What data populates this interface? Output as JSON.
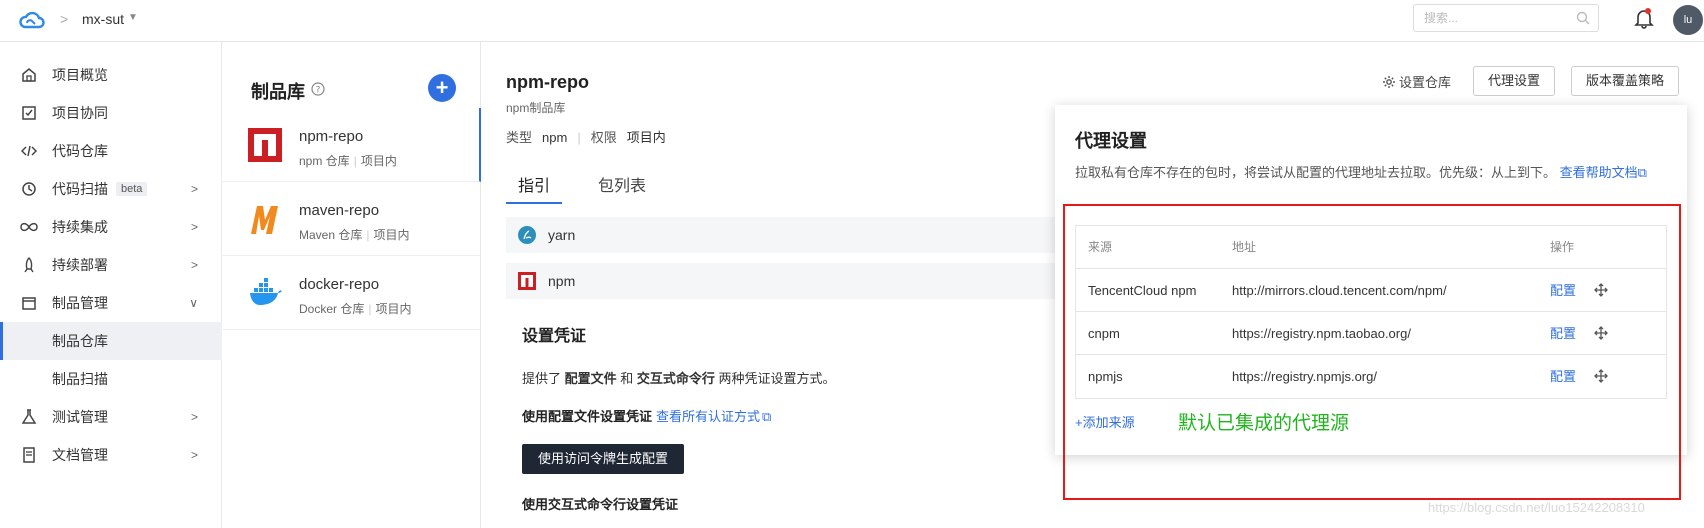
{
  "topbar": {
    "project_name": "mx-sut",
    "search_placeholder": "搜索...",
    "avatar_text": "lu"
  },
  "sidebar": {
    "items": [
      {
        "label": "项目概览",
        "icon": "home-icon"
      },
      {
        "label": "项目协同",
        "icon": "checkbox-icon"
      },
      {
        "label": "代码仓库",
        "icon": "code-icon"
      },
      {
        "label": "代码扫描",
        "icon": "scan-icon",
        "badge": "beta"
      },
      {
        "label": "持续集成",
        "icon": "infinity-icon"
      },
      {
        "label": "持续部署",
        "icon": "rocket-icon"
      },
      {
        "label": "制品管理",
        "icon": "box-icon"
      },
      {
        "label": "制品仓库"
      },
      {
        "label": "制品扫描"
      },
      {
        "label": "测试管理",
        "icon": "flask-icon"
      },
      {
        "label": "文档管理",
        "icon": "doc-icon"
      }
    ]
  },
  "repolist": {
    "title": "制品库",
    "repos": [
      {
        "name": "npm-repo",
        "type": "npm 仓库",
        "scope": "项目内"
      },
      {
        "name": "maven-repo",
        "type": "Maven 仓库",
        "scope": "项目内"
      },
      {
        "name": "docker-repo",
        "type": "Docker 仓库",
        "scope": "项目内"
      }
    ]
  },
  "main": {
    "title": "npm-repo",
    "subtitle": "npm制品库",
    "type_label": "类型",
    "type_value": "npm",
    "perm_label": "权限",
    "perm_value": "项目内",
    "set_repo": "设置仓库",
    "proxy_btn": "代理设置",
    "version_btn": "版本覆盖策略",
    "tabs": [
      "指引",
      "包列表"
    ],
    "packages": [
      "yarn",
      "npm"
    ],
    "cred_title": "设置凭证",
    "cred_text_a": "提供了 ",
    "cred_text_b": "配置文件",
    "cred_text_c": " 和 ",
    "cred_text_d": "交互式命令行",
    "cred_text_e": " 两种凭证设置方式。",
    "cred_sub1": "使用配置文件设置凭证",
    "cred_sub1_link": "查看所有认证方式",
    "gen_btn": "使用访问令牌生成配置",
    "cred_sub2": "使用交互式命令行设置凭证"
  },
  "panel": {
    "title": "代理设置",
    "desc": "拉取私有仓库不存在的包时，将尝试从配置的代理地址去拉取。优先级：从上到下。",
    "help_link": "查看帮助文档",
    "headers": [
      "来源",
      "地址",
      "操作"
    ],
    "rows": [
      {
        "source": "TencentCloud npm",
        "url": "http://mirrors.cloud.tencent.com/npm/",
        "action": "配置"
      },
      {
        "source": "cnpm",
        "url": "https://registry.npm.taobao.org/",
        "action": "配置"
      },
      {
        "source": "npmjs",
        "url": "https://registry.npmjs.org/",
        "action": "配置"
      }
    ],
    "add_source": "+添加来源"
  },
  "annotation": "默认已集成的代理源",
  "watermark": "https://blog.csdn.net/luo15242208310",
  "colors": {
    "accent": "#2f6fdf",
    "annotation": "#22b41f",
    "frame": "#e31b1b",
    "npm_red": "#cb1f24",
    "maven_orange": "#f08a1c",
    "docker_blue": "#2496ed"
  }
}
